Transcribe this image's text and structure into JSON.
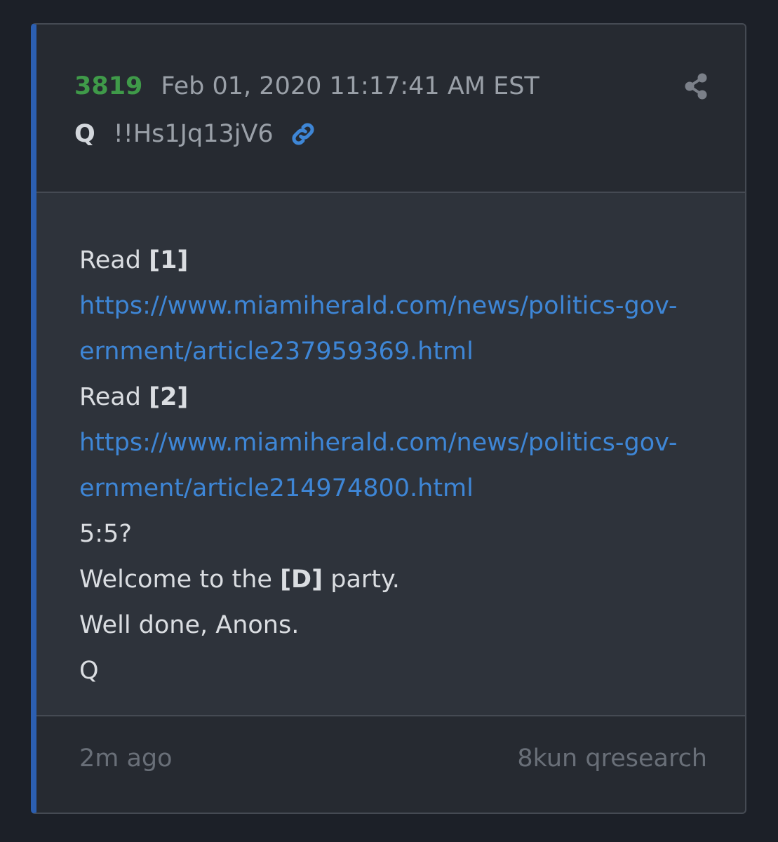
{
  "post": {
    "number": "3819",
    "date": "Feb 01, 2020 11:17:41 AM EST",
    "author": "Q",
    "tripcode": "!!Hs1Jq13jV6",
    "icons": {
      "share": "share-icon",
      "permalink": "link-icon"
    },
    "accent_color": "#2c5fb1",
    "number_color": "#3f9a49",
    "link_color": "#3e86d6"
  },
  "content": {
    "line1_prefix": "Read ",
    "line1_ref": "[1]",
    "link1_line1": "https://www.miamiherald.com/news/politics-gov-",
    "link1_line2": "ernment/article237959369.html",
    "line2_prefix": "Read ",
    "line2_ref": "[2]",
    "link2_line1": "https://www.miamiherald.com/news/politics-gov-",
    "link2_line2": "ernment/article214974800.html",
    "line3": "5:5?",
    "line4_prefix": "Welcome to the ",
    "line4_ref": "[D]",
    "line4_suffix": " party.",
    "line5": "Well done, Anons.",
    "line6": "Q"
  },
  "footer": {
    "time_ago": "2m ago",
    "source": "8kun qresearch"
  }
}
